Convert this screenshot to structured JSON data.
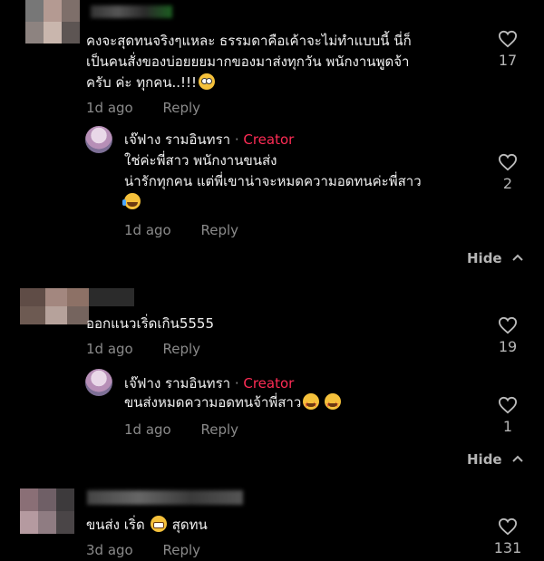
{
  "comments": [
    {
      "text_lines": [
        "คงจะสุดทนจริงๆแหละ ธรรมดาคือเค้าจะไม่ทำแบบนี้ นี่ก็",
        "เป็นคนสั่งของบ่อยยยมากของมาส่งทุกวัน พนักงานพูดจ้า",
        "ครับ ค่ะ ทุกคน..!!!"
      ],
      "time": "1d ago",
      "reply": "Reply",
      "likes": "17",
      "replies": [
        {
          "author": "เจ๊ฟาง รามอินทรา",
          "sep": " · ",
          "badge": "Creator",
          "text_lines": [
            "ใช่ค่ะพี่สาว พนักงานขนส่ง",
            "น่ารักทุกคน แต่พี่เขาน่าจะหมดความอดทนค่ะพี่สาว"
          ],
          "time": "1d ago",
          "reply": "Reply",
          "likes": "2"
        }
      ],
      "hide": "Hide"
    },
    {
      "text_lines": [
        "ออกแนวเริ่ดเกิน5555"
      ],
      "time": "1d ago",
      "reply": "Reply",
      "likes": "19",
      "replies": [
        {
          "author": "เจ๊ฟาง รามอินทรา",
          "sep": " · ",
          "badge": "Creator",
          "text_lines": [
            "ขนส่งหมดความอดทนจ้าพี่สาว"
          ],
          "time": "1d ago",
          "reply": "Reply",
          "likes": "1"
        }
      ],
      "hide": "Hide"
    },
    {
      "text_lines": [
        "ขนส่ง เริ่ด",
        "สุดทน"
      ],
      "time": "3d ago",
      "reply": "Reply",
      "likes": "131"
    }
  ],
  "colors": {
    "background": "#000000",
    "creator_badge": "#fe2c55",
    "meta": "#8a8a8a"
  },
  "icons": {
    "like": "heart-outline-icon",
    "collapse": "chevron-up-icon"
  }
}
